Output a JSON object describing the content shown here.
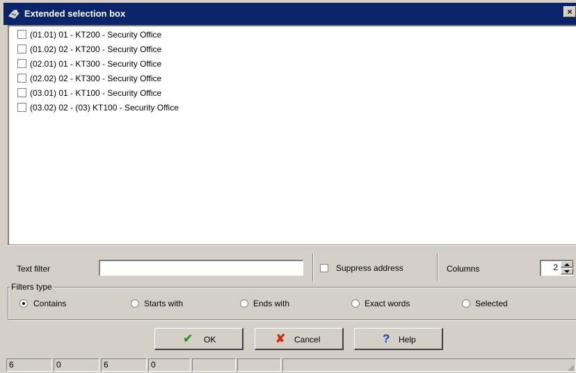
{
  "window": {
    "title": "Extended selection box",
    "close_label": "×"
  },
  "list": {
    "items": [
      {
        "label": "(01.01) 01 - KT200 - Security Office",
        "checked": false
      },
      {
        "label": "(01.02) 02 - KT200 - Security Office",
        "checked": false
      },
      {
        "label": "(02.01) 01 - KT300 - Security Office",
        "checked": false
      },
      {
        "label": "(02.02) 02 - KT300 - Security Office",
        "checked": false
      },
      {
        "label": "(03.01) 01 - KT100 - Security Office",
        "checked": false
      },
      {
        "label": "(03.02) 02 - (03) KT100 - Security Office",
        "checked": false
      }
    ]
  },
  "filter": {
    "text_filter_label": "Text filter",
    "text_filter_value": "",
    "suppress_address_label": "Suppress address",
    "suppress_address_checked": false,
    "columns_label": "Columns",
    "columns_value": "2"
  },
  "filters_type": {
    "label": "Filters type",
    "options": [
      "Contains",
      "Starts with",
      "Ends with",
      "Exact words",
      "Selected"
    ],
    "selected": "Contains"
  },
  "buttons": {
    "ok": "OK",
    "cancel": "Cancel",
    "help": "Help"
  },
  "status": [
    "6",
    "0",
    "6",
    "0",
    "",
    "",
    ""
  ],
  "colors": {
    "titlebar": "#0a246a",
    "ok_icon": "#2e9a1e",
    "cancel_icon": "#d42a0a",
    "help_icon": "#1a3fcf"
  }
}
